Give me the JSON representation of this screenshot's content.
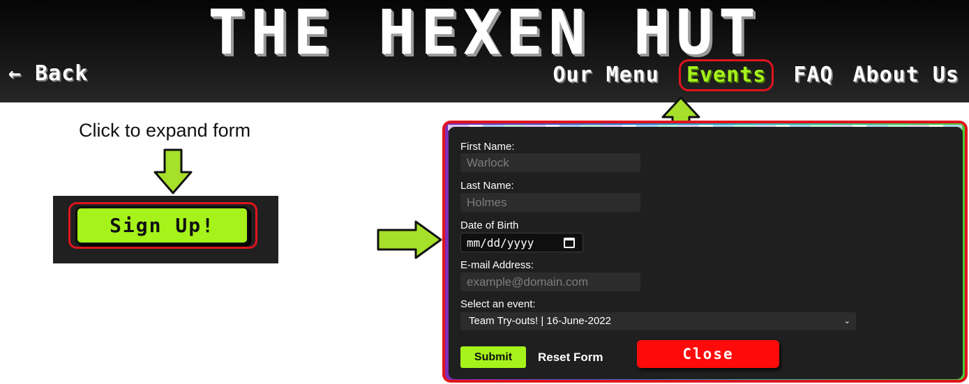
{
  "header": {
    "title": "THE HEXEN HUT",
    "back_label": "← Back",
    "nav": [
      {
        "label": "Our Menu",
        "active": false
      },
      {
        "label": "Events",
        "active": true
      },
      {
        "label": "FAQ",
        "active": false
      },
      {
        "label": "About Us",
        "active": false
      }
    ]
  },
  "annotation": {
    "instruction": "Click to expand form",
    "arrow_color": "#a6e02a",
    "highlight_color": "#e0141e"
  },
  "signup": {
    "label": "Sign Up!"
  },
  "form": {
    "first_name_label": "First Name:",
    "first_name_placeholder": "Warlock",
    "last_name_label": "Last Name:",
    "last_name_placeholder": "Holmes",
    "dob_label": "Date of Birth",
    "dob_value": "mm/dd/yyyy",
    "email_label": "E-mail Address:",
    "email_placeholder": "example@domain.com",
    "event_label": "Select an event:",
    "event_selected": "Team Try-outs! | 16-June-2022",
    "submit_label": "Submit",
    "reset_label": "Reset Form",
    "close_label": "Close"
  },
  "colors": {
    "accent": "#a6f21b",
    "close": "#ff0a0a",
    "form_bg": "#1f1f1f"
  }
}
